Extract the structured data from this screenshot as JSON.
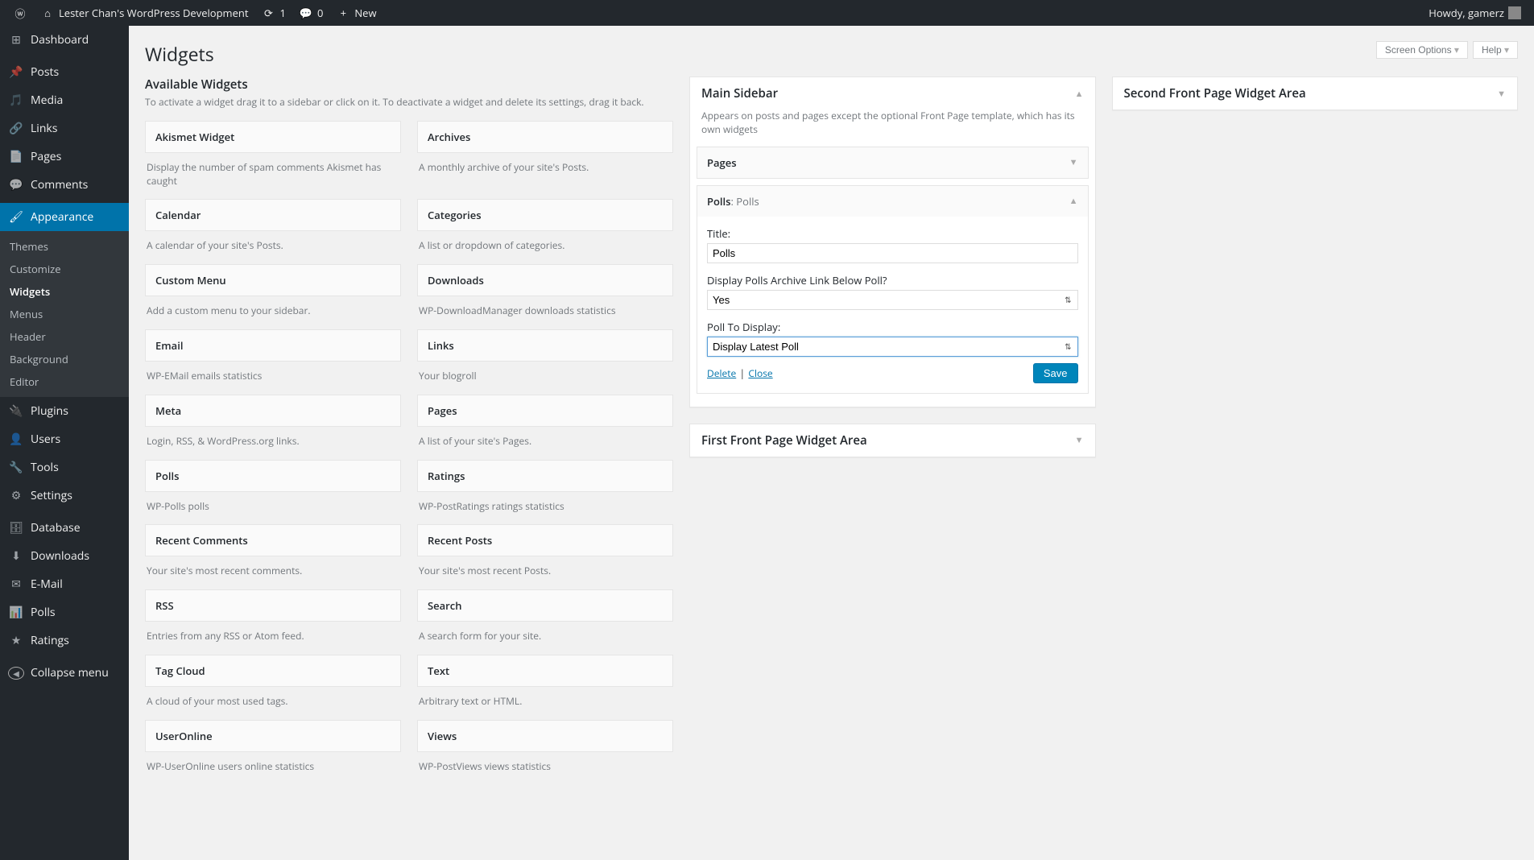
{
  "adminbar": {
    "site_title": "Lester Chan's WordPress Development",
    "updates": "1",
    "comments": "0",
    "new_label": "New",
    "howdy": "Howdy, gamerz"
  },
  "menu": {
    "dashboard": "Dashboard",
    "posts": "Posts",
    "media": "Media",
    "links": "Links",
    "pages": "Pages",
    "comments": "Comments",
    "appearance": "Appearance",
    "appearance_sub": {
      "themes": "Themes",
      "customize": "Customize",
      "widgets": "Widgets",
      "menus": "Menus",
      "header": "Header",
      "background": "Background",
      "editor": "Editor"
    },
    "plugins": "Plugins",
    "users": "Users",
    "tools": "Tools",
    "settings": "Settings",
    "database": "Database",
    "downloads": "Downloads",
    "email": "E-Mail",
    "polls": "Polls",
    "ratings": "Ratings",
    "collapse": "Collapse menu"
  },
  "header": {
    "page_title": "Widgets",
    "screen_options": "Screen Options",
    "help": "Help"
  },
  "available": {
    "title": "Available Widgets",
    "desc": "To activate a widget drag it to a sidebar or click on it. To deactivate a widget and delete its settings, drag it back.",
    "list": [
      {
        "title": "Akismet Widget",
        "desc": "Display the number of spam comments Akismet has caught"
      },
      {
        "title": "Archives",
        "desc": "A monthly archive of your site's Posts."
      },
      {
        "title": "Calendar",
        "desc": "A calendar of your site's Posts."
      },
      {
        "title": "Categories",
        "desc": "A list or dropdown of categories."
      },
      {
        "title": "Custom Menu",
        "desc": "Add a custom menu to your sidebar."
      },
      {
        "title": "Downloads",
        "desc": "WP-DownloadManager downloads statistics"
      },
      {
        "title": "Email",
        "desc": "WP-EMail emails statistics"
      },
      {
        "title": "Links",
        "desc": "Your blogroll"
      },
      {
        "title": "Meta",
        "desc": "Login, RSS, & WordPress.org links."
      },
      {
        "title": "Pages",
        "desc": "A list of your site's Pages."
      },
      {
        "title": "Polls",
        "desc": "WP-Polls polls"
      },
      {
        "title": "Ratings",
        "desc": "WP-PostRatings ratings statistics"
      },
      {
        "title": "Recent Comments",
        "desc": "Your site's most recent comments."
      },
      {
        "title": "Recent Posts",
        "desc": "Your site's most recent Posts."
      },
      {
        "title": "RSS",
        "desc": "Entries from any RSS or Atom feed."
      },
      {
        "title": "Search",
        "desc": "A search form for your site."
      },
      {
        "title": "Tag Cloud",
        "desc": "A cloud of your most used tags."
      },
      {
        "title": "Text",
        "desc": "Arbitrary text or HTML."
      },
      {
        "title": "UserOnline",
        "desc": "WP-UserOnline users online statistics"
      },
      {
        "title": "Views",
        "desc": "WP-PostViews views statistics"
      }
    ]
  },
  "sidebars": {
    "main": {
      "title": "Main Sidebar",
      "desc": "Appears on posts and pages except the optional Front Page template, which has its own widgets",
      "pages_widget": "Pages",
      "polls_widget_name": "Polls",
      "polls_widget_sub": ": Polls",
      "form": {
        "title_label": "Title:",
        "title_value": "Polls",
        "archive_label": "Display Polls Archive Link Below Poll?",
        "archive_value": "Yes",
        "display_label": "Poll To Display:",
        "display_value": "Display Latest Poll",
        "delete": "Delete",
        "close": "Close",
        "save": "Save"
      }
    },
    "first_fp": {
      "title": "First Front Page Widget Area"
    },
    "second_fp": {
      "title": "Second Front Page Widget Area"
    }
  }
}
